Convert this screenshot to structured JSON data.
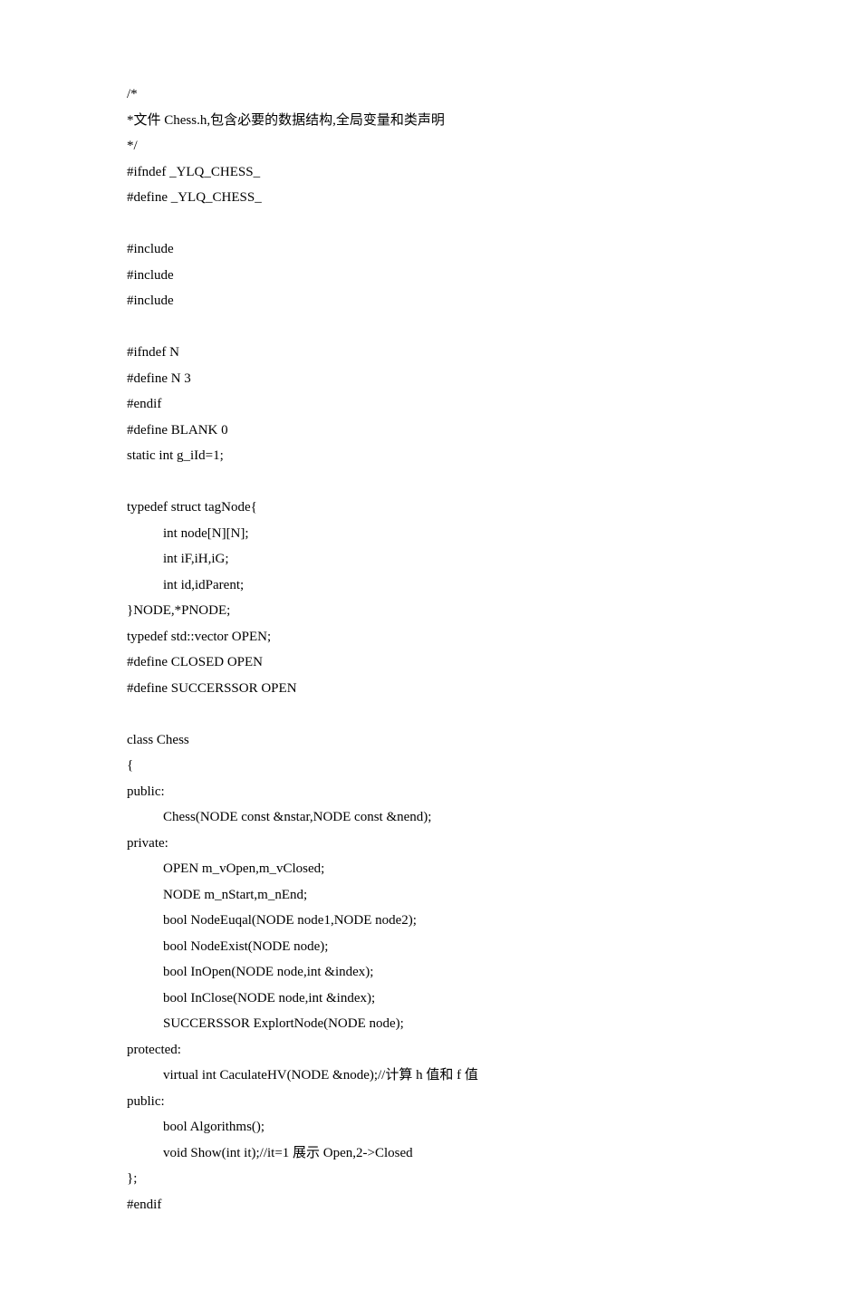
{
  "lines": [
    {
      "text": "/*",
      "indent": 0
    },
    {
      "text": "*文件 Chess.h,包含必要的数据结构,全局变量和类声明",
      "indent": 0
    },
    {
      "text": "*/",
      "indent": 0
    },
    {
      "text": "#ifndef _YLQ_CHESS_",
      "indent": 0
    },
    {
      "text": "#define _YLQ_CHESS_",
      "indent": 0
    },
    {
      "text": "",
      "indent": 0
    },
    {
      "text": "#include",
      "indent": 0
    },
    {
      "text": "#include",
      "indent": 0
    },
    {
      "text": "#include",
      "indent": 0
    },
    {
      "text": "",
      "indent": 0
    },
    {
      "text": "#ifndef N",
      "indent": 0
    },
    {
      "text": "#define N 3",
      "indent": 0
    },
    {
      "text": "#endif",
      "indent": 0
    },
    {
      "text": "#define BLANK 0",
      "indent": 0
    },
    {
      "text": "static int g_iId=1;",
      "indent": 0
    },
    {
      "text": "",
      "indent": 0
    },
    {
      "text": "typedef struct tagNode{",
      "indent": 0
    },
    {
      "text": "int node[N][N];",
      "indent": 1
    },
    {
      "text": "int iF,iH,iG;",
      "indent": 1
    },
    {
      "text": "int id,idParent;",
      "indent": 1
    },
    {
      "text": "}NODE,*PNODE;",
      "indent": 0
    },
    {
      "text": "typedef std::vector OPEN;",
      "indent": 0
    },
    {
      "text": "#define CLOSED OPEN",
      "indent": 0
    },
    {
      "text": "#define SUCCERSSOR OPEN",
      "indent": 0
    },
    {
      "text": "",
      "indent": 0
    },
    {
      "text": "class Chess",
      "indent": 0
    },
    {
      "text": "{",
      "indent": 0
    },
    {
      "text": "public:",
      "indent": 0
    },
    {
      "text": "Chess(NODE const &nstar,NODE const &nend);",
      "indent": 1
    },
    {
      "text": "private:",
      "indent": 0
    },
    {
      "text": "OPEN m_vOpen,m_vClosed;",
      "indent": 1
    },
    {
      "text": "NODE m_nStart,m_nEnd;",
      "indent": 1
    },
    {
      "text": "bool NodeEuqal(NODE node1,NODE node2);",
      "indent": 1
    },
    {
      "text": "bool NodeExist(NODE node);",
      "indent": 1
    },
    {
      "text": "bool InOpen(NODE node,int &index);",
      "indent": 1
    },
    {
      "text": "bool InClose(NODE node,int &index);",
      "indent": 1
    },
    {
      "text": "SUCCERSSOR ExplortNode(NODE node);",
      "indent": 1
    },
    {
      "text": "protected:",
      "indent": 0
    },
    {
      "text": "virtual int CaculateHV(NODE &node);//计算 h 值和 f 值",
      "indent": 1
    },
    {
      "text": "public:",
      "indent": 0
    },
    {
      "text": "bool Algorithms();",
      "indent": 1
    },
    {
      "text": "void Show(int it);//it=1 展示 Open,2->Closed",
      "indent": 1
    },
    {
      "text": "};",
      "indent": 0
    },
    {
      "text": "#endif",
      "indent": 0
    }
  ]
}
